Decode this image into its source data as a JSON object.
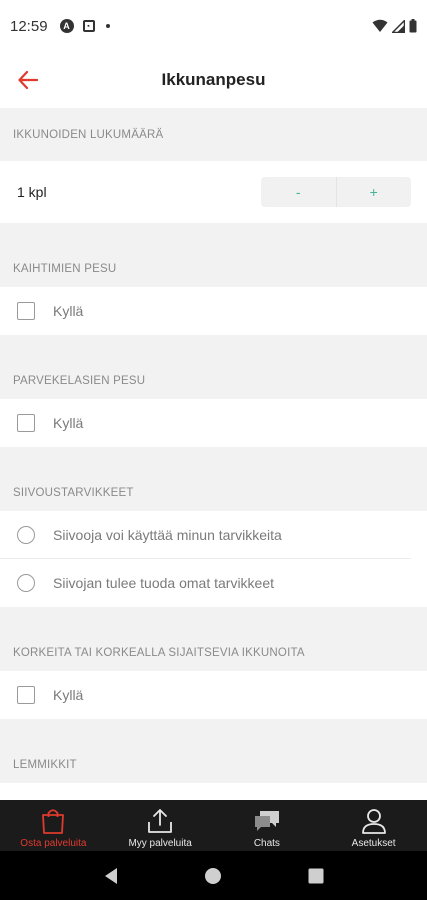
{
  "status_bar": {
    "time": "12:59",
    "icons": [
      "app-a-icon",
      "app-b-icon",
      "dot-icon",
      "wifi-icon",
      "signal-icon",
      "battery-icon"
    ]
  },
  "header": {
    "title": "Ikkunanpesu",
    "back_icon": "arrow-left-icon"
  },
  "colors": {
    "accent": "#e03a2e",
    "stepper": "#3fb59a",
    "nav_bg": "#1b1b1b"
  },
  "sections": {
    "window_count": {
      "label": "IKKUNOIDEN LUKUMÄÄRÄ",
      "value": "1 kpl",
      "minus": "-",
      "plus": "+"
    },
    "blinds": {
      "label": "KAIHTIMIEN PESU",
      "option": "Kyllä"
    },
    "balcony": {
      "label": "PARVEKELASIEN PESU",
      "option": "Kyllä"
    },
    "supplies": {
      "label": "SIIVOUSTARVIKKEET",
      "options": [
        "Siivooja voi käyttää minun tarvikkeita",
        "Siivojan tulee tuoda omat tarvikkeet"
      ]
    },
    "high_windows": {
      "label": "KORKEITA TAI KORKEALLA SIJAITSEVIA IKKUNOITA",
      "option": "Kyllä"
    },
    "pets": {
      "label": "LEMMIKKIT"
    }
  },
  "bottom_nav": [
    {
      "label": "Osta palveluita",
      "icon": "shopping-bag-icon",
      "active": true
    },
    {
      "label": "Myy palveluita",
      "icon": "upload-icon",
      "active": false
    },
    {
      "label": "Chats",
      "icon": "chat-bubbles-icon",
      "active": false
    },
    {
      "label": "Asetukset",
      "icon": "user-icon",
      "active": false
    }
  ]
}
